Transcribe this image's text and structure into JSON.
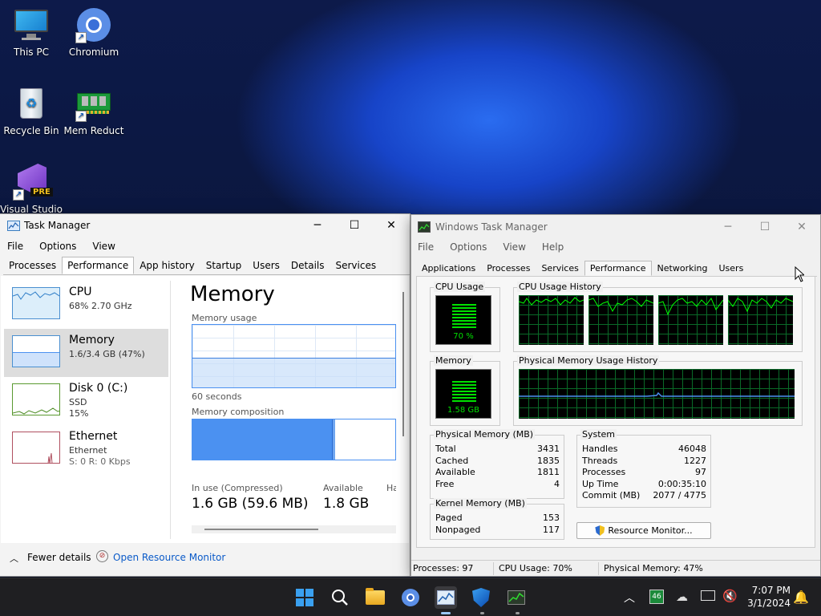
{
  "desktop": {
    "icons": [
      {
        "label": "This PC"
      },
      {
        "label": "Chromium"
      },
      {
        "label": "Recycle Bin"
      },
      {
        "label": "Mem Reduct"
      },
      {
        "label": "Visual Studio",
        "badge": "PRE"
      }
    ]
  },
  "tm_new": {
    "title": "Task Manager",
    "menu": [
      "File",
      "Options",
      "View"
    ],
    "tabs": [
      "Processes",
      "Performance",
      "App history",
      "Startup",
      "Users",
      "Details",
      "Services"
    ],
    "active_tab": "Performance",
    "sidebar": [
      {
        "title": "CPU",
        "sub1": "68% 2.70 GHz",
        "sub2": ""
      },
      {
        "title": "Memory",
        "sub1": "1.6/3.4 GB (47%)",
        "sub2": ""
      },
      {
        "title": "Disk 0 (C:)",
        "sub1": "SSD",
        "sub2": "15%"
      },
      {
        "title": "Ethernet",
        "sub1": "Ethernet",
        "sub2": "S: 0 R: 0 Kbps"
      }
    ],
    "selected": "Memory",
    "detail": {
      "heading": "Memory",
      "usage_label": "Memory usage",
      "seconds_label": "60 seconds",
      "composition_label": "Memory composition",
      "in_use_label": "In use (Compressed)",
      "in_use_value": "1.6 GB (59.6 MB)",
      "available_label": "Available",
      "available_value": "1.8 GB",
      "cut_label": "Ha",
      "usage_fraction": 0.47
    },
    "footer": {
      "fewer": "Fewer details",
      "resource": "Open Resource Monitor"
    }
  },
  "tm_classic": {
    "title": "Windows Task Manager",
    "menu": [
      "File",
      "Options",
      "View",
      "Help"
    ],
    "tabs": [
      "Applications",
      "Processes",
      "Services",
      "Performance",
      "Networking",
      "Users"
    ],
    "active_tab": "Performance",
    "cpu_usage_label": "CPU Usage",
    "cpu_usage_value": "70 %",
    "cpu_history_label": "CPU Usage History",
    "memory_label": "Memory",
    "memory_value": "1.58 GB",
    "mem_history_label": "Physical Memory Usage History",
    "physical": {
      "label": "Physical Memory (MB)",
      "rows": [
        {
          "k": "Total",
          "v": "3431"
        },
        {
          "k": "Cached",
          "v": "1835"
        },
        {
          "k": "Available",
          "v": "1811"
        },
        {
          "k": "Free",
          "v": "4"
        }
      ]
    },
    "system": {
      "label": "System",
      "rows": [
        {
          "k": "Handles",
          "v": "46048"
        },
        {
          "k": "Threads",
          "v": "1227"
        },
        {
          "k": "Processes",
          "v": "97"
        },
        {
          "k": "Up Time",
          "v": "0:00:35:10"
        },
        {
          "k": "Commit (MB)",
          "v": "2077 / 4775"
        }
      ]
    },
    "kernel": {
      "label": "Kernel Memory (MB)",
      "rows": [
        {
          "k": "Paged",
          "v": "153"
        },
        {
          "k": "Nonpaged",
          "v": "117"
        }
      ]
    },
    "resource_button": "Resource Monitor...",
    "status": {
      "processes": "Processes: 97",
      "cpu": "CPU Usage: 70%",
      "memory": "Physical Memory: 47%"
    }
  },
  "taskbar": {
    "time": "7:07 PM",
    "date": "3/1/2024",
    "tray_badge": "46"
  },
  "colors": {
    "accent": "#0078d4",
    "memory_blue": "#4b91f1",
    "graph_green": "#00ff00"
  }
}
